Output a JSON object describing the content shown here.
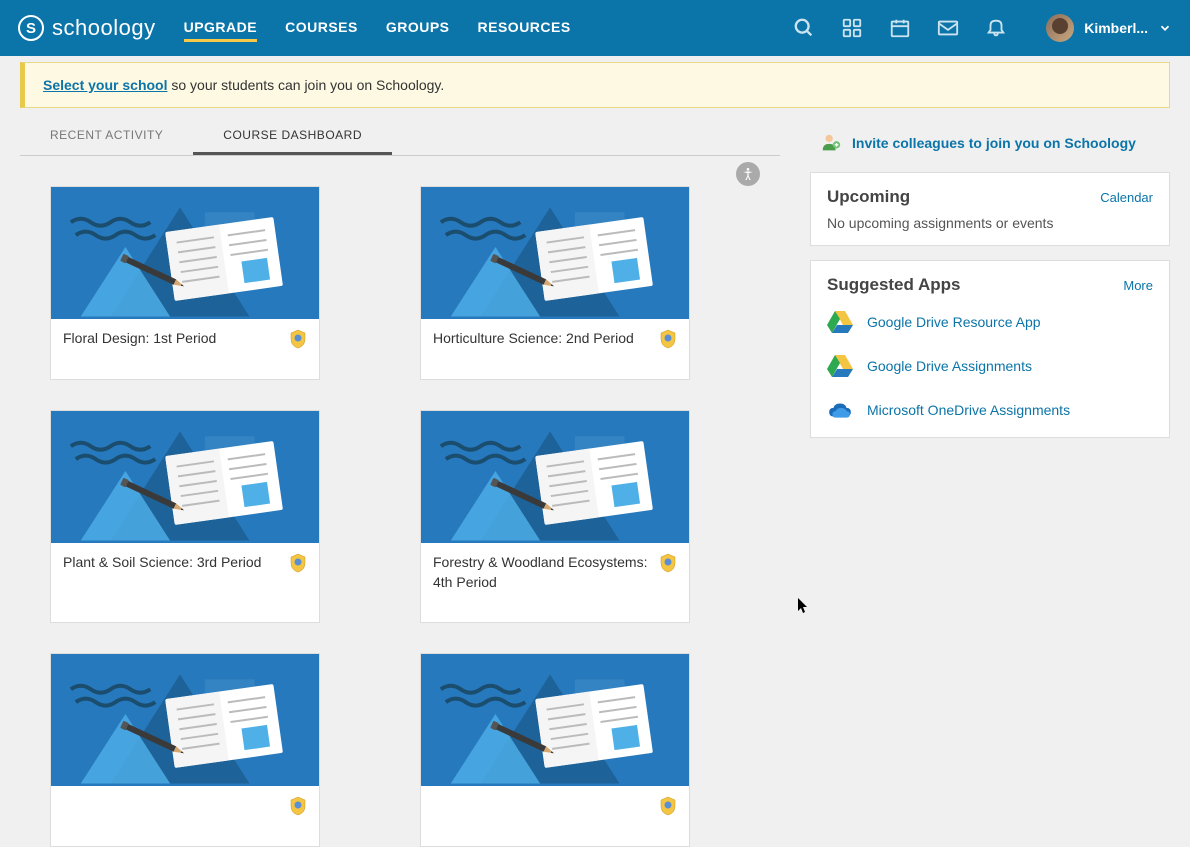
{
  "brand": {
    "letter": "S",
    "name": "schoology"
  },
  "nav": {
    "upgrade": "UPGRADE",
    "courses": "COURSES",
    "groups": "GROUPS",
    "resources": "RESOURCES"
  },
  "user": {
    "name": "Kimberl..."
  },
  "banner": {
    "link": "Select your school",
    "rest": " so your students can join you on Schoology."
  },
  "tabs": {
    "recent": "RECENT ACTIVITY",
    "dashboard": "COURSE DASHBOARD"
  },
  "courses": [
    {
      "title": "Floral Design: 1st Period"
    },
    {
      "title": "Horticulture Science: 2nd Period"
    },
    {
      "title": "Plant & Soil Science: 3rd Period"
    },
    {
      "title": "Forestry & Woodland Ecosystems: 4th Period"
    },
    {
      "title": ""
    },
    {
      "title": ""
    }
  ],
  "invite": "Invite colleagues to join you on Schoology",
  "upcoming": {
    "title": "Upcoming",
    "calendar": "Calendar",
    "empty": "No upcoming assignments or events"
  },
  "apps": {
    "title": "Suggested Apps",
    "more": "More",
    "items": [
      {
        "name": "Google Drive Resource App",
        "icon": "gdrive"
      },
      {
        "name": "Google Drive Assignments",
        "icon": "gdrive"
      },
      {
        "name": "Microsoft OneDrive Assignments",
        "icon": "onedrive"
      }
    ]
  }
}
